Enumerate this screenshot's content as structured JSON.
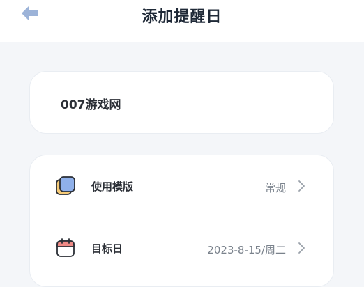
{
  "header": {
    "title": "添加提醒日",
    "back_icon": "arrow-left-icon",
    "accent_color": "#9cb3d8"
  },
  "event": {
    "name": "007游戏网"
  },
  "settings": {
    "rows": [
      {
        "label": "使用模版",
        "value": "常规",
        "icon": "template-cards-icon"
      },
      {
        "label": "目标日",
        "value": "2023-8-15/周二",
        "icon": "calendar-icon"
      }
    ],
    "chevron_icon": "chevron-right-icon"
  }
}
